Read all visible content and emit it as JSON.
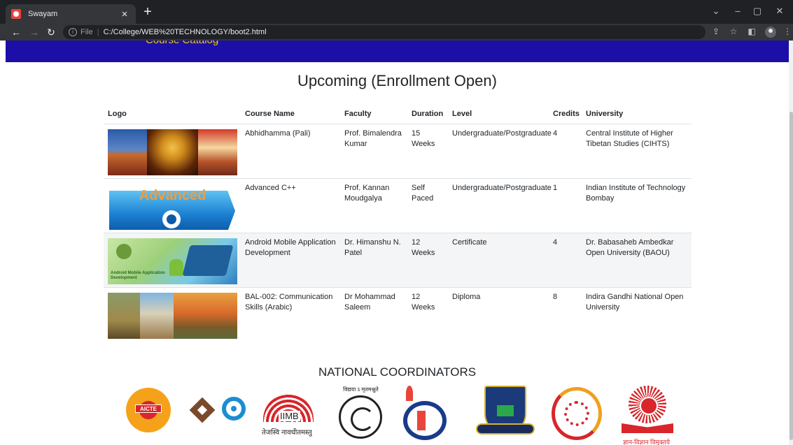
{
  "browser": {
    "tab_title": "Swayam",
    "tab_close": "×",
    "new_tab": "+",
    "file_label": "File",
    "separator": "|",
    "url": "C:/College/WEB%20TECHNOLOGY/boot2.html",
    "icons": [
      "back-arrow-icon",
      "forward-arrow-icon",
      "reload-icon",
      "info-icon",
      "share-icon",
      "star-icon",
      "side-panel-icon",
      "profile-icon",
      "menu-icon"
    ]
  },
  "page": {
    "nav_partial_text": "Course Catalog",
    "heading": "Upcoming (Enrollment Open)",
    "table": {
      "headers": [
        "Logo",
        "Course Name",
        "Faculty",
        "Duration",
        "Level",
        "Credits",
        "University"
      ],
      "rows": [
        {
          "course": "Abhidhamma (Pali)",
          "faculty": "Prof. Bimalendra Kumar",
          "duration": "15 Weeks",
          "level": "Undergraduate/Postgraduate",
          "credits": "4",
          "university": "Central Institute of Higher Tibetan Studies (CIHTS)"
        },
        {
          "course": "Advanced C++",
          "faculty": "Prof. Kannan Moudgalya",
          "duration": "Self Paced",
          "level": "Undergraduate/Postgraduate",
          "credits": "1",
          "university": "Indian Institute of Technology Bombay",
          "logo_text": "Advanced"
        },
        {
          "course": "Android Mobile Application Development",
          "faculty": "Dr. Himanshu N. Patel",
          "duration": "12 Weeks",
          "level": "Certificate",
          "credits": "4",
          "university": "Dr. Babasaheb Ambedkar Open University (BAOU)",
          "logo_text": "Android Mobile Application Development"
        },
        {
          "course": "BAL-002: Communication Skills (Arabic)",
          "faculty": "Dr Mohammad Saleem",
          "duration": "12 Weeks",
          "level": "Diploma",
          "credits": "8",
          "university": "Indira Gandhi National Open University"
        }
      ]
    },
    "coordinators_title": "NATIONAL COORDINATORS",
    "coordinator_logos": {
      "aicte": "AICTE",
      "iimb": "IIMB",
      "iimb_motto": "तेजस्वि नावधीतमस्तु",
      "vidya_motto": "विद्यया ऽ मृतमश्नुते",
      "ugc_motto": "ज्ञान-विज्ञान विमुक्तये"
    }
  },
  "colors": {
    "navbar": "#1b0fa8",
    "nav_text": "#f0c419",
    "browser_dark": "#202124",
    "browser_toolbar": "#35363a"
  }
}
